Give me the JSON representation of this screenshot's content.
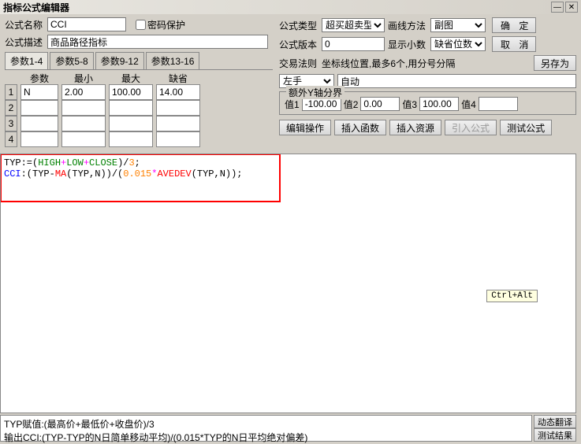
{
  "window": {
    "title": "指标公式编辑器"
  },
  "labels": {
    "name": "公式名称",
    "desc": "公式描述",
    "pwd": "密码保护",
    "type": "公式类型",
    "draw": "画线方法",
    "ver": "公式版本",
    "dec": "显示小数",
    "rule": "交易法则",
    "coord_note": "坐标线位置,最多6个,用分号分隔",
    "hand": "左手",
    "yaxis": "额外Y轴分界",
    "v1": "值1",
    "v2": "值2",
    "v3": "值3",
    "v4": "值4"
  },
  "fields": {
    "name": "CCI",
    "desc": "商品路径指标",
    "type": "超买超卖型",
    "draw": "副图",
    "ver": "0",
    "dec": "缺省位数",
    "hand_auto": "自动",
    "y1": "-100.00",
    "y2": "0.00",
    "y3": "100.00",
    "y4": ""
  },
  "pwd_checked": false,
  "buttons": {
    "ok": "确 定",
    "cancel": "取 消",
    "saveas": "另存为",
    "edit": "编辑操作",
    "insfn": "插入函数",
    "insres": "插入资源",
    "import": "引入公式",
    "test": "测试公式",
    "dyntrans": "动态翻译",
    "testres": "测试结果"
  },
  "tabs": [
    "参数1-4",
    "参数5-8",
    "参数9-12",
    "参数13-16"
  ],
  "param_headers": [
    "参数",
    "最小",
    "最大",
    "缺省"
  ],
  "param_rows": [
    {
      "n": "1",
      "name": "N",
      "min": "2.00",
      "max": "100.00",
      "def": "14.00"
    },
    {
      "n": "2",
      "name": "",
      "min": "",
      "max": "",
      "def": ""
    },
    {
      "n": "3",
      "name": "",
      "min": "",
      "max": "",
      "def": ""
    },
    {
      "n": "4",
      "name": "",
      "min": "",
      "max": "",
      "def": ""
    }
  ],
  "code": {
    "l1a": "TYP:=(",
    "l1b": "HIGH",
    "l1c": "+",
    "l1d": "LOW",
    "l1e": "+",
    "l1f": "CLOSE",
    "l1g": ")/",
    "l1h": "3",
    "l1i": ";",
    "l2a": "CCI",
    "l2b": ":(TYP-",
    "l2c": "MA",
    "l2d": "(TYP,N))/(",
    "l2e": "0.015",
    "l2f": "*",
    "l2g": "AVEDEV",
    "l2h": "(TYP,N));"
  },
  "tooltip": "Ctrl+Alt",
  "explain": {
    "l1": "TYP赋值:(最高价+最低价+收盘价)/3",
    "l2": "输出CCI:(TYP-TYP的N日简单移动平均)/(0.015*TYP的N日平均绝对偏差)"
  }
}
